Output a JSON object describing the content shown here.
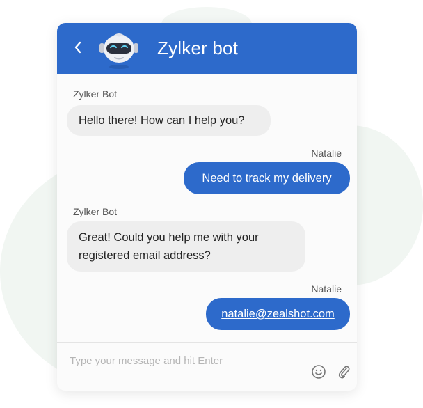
{
  "header": {
    "title": "Zylker bot",
    "back_icon": "chevron-left-icon",
    "avatar_icon": "robot-avatar-icon",
    "color": "#2d6acb"
  },
  "messages": [
    {
      "sender": "Zylker Bot",
      "text": "Hello there! How can I help you?",
      "from": "bot"
    },
    {
      "sender": "Natalie",
      "text": "Need to track my delivery",
      "from": "user"
    },
    {
      "sender": "Zylker Bot",
      "text_lines": [
        "Great! Could you help me with your",
        "registered email address?"
      ],
      "from": "bot"
    },
    {
      "sender": "Natalie",
      "text": "natalie@zealshot.com",
      "from": "user",
      "is_link": true
    }
  ],
  "composer": {
    "placeholder": "Type your message and hit Enter",
    "emoji_icon": "emoji-icon",
    "attach_icon": "paperclip-icon"
  }
}
